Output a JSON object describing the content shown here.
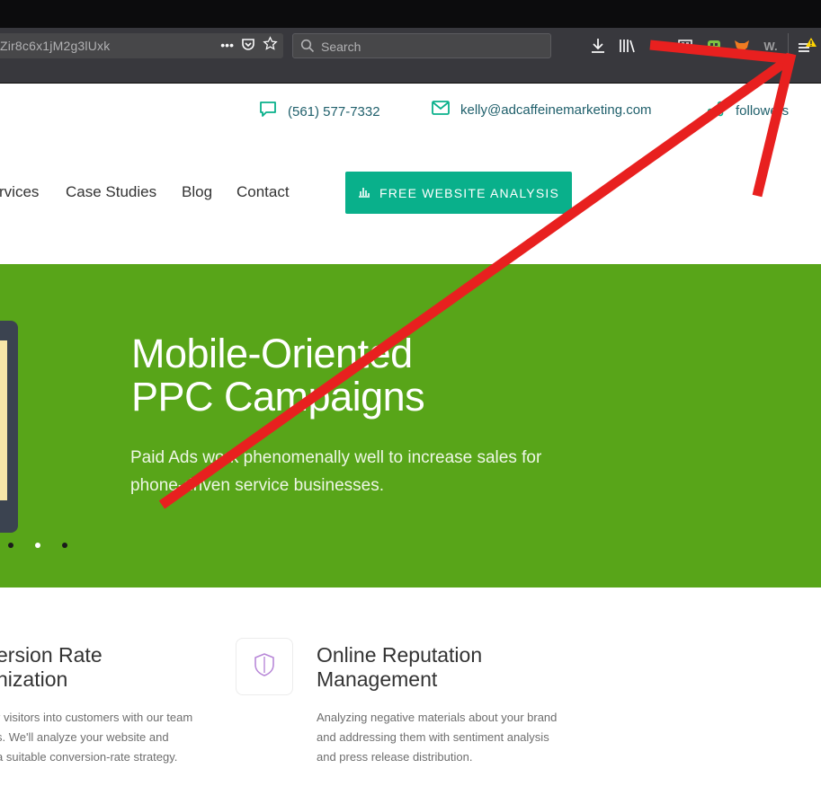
{
  "browser": {
    "url_text": "Zir8c6x1jM2g3lUxk",
    "url_more": "•••",
    "search_placeholder": "Search",
    "menu_warning_color": "#ffd400"
  },
  "contact": {
    "phone": "(561) 577-7332",
    "email": "kelly@adcaffeinemarketing.com",
    "followers": "followers"
  },
  "nav": {
    "items": [
      "rvices",
      "Case Studies",
      "Blog",
      "Contact"
    ],
    "cta_label": "FREE WEBSITE ANALYSIS"
  },
  "hero": {
    "title_line1": "Mobile-Oriented",
    "title_line2": "PPC Campaigns",
    "desc_line1": "Paid Ads work phenomenally well to increase sales for",
    "desc_line2": "phone-driven service businesses.",
    "slide_count": 3,
    "active_slide": 2,
    "background_color": "#58a519"
  },
  "services": [
    {
      "title_line1": "ersion Rate",
      "title_line2": "nization",
      "desc_lines": [
        "r visitors into customers with our team",
        "s. We'll analyze your website and",
        "a suitable conversion-rate strategy."
      ]
    },
    {
      "title_line1": "Online Reputation",
      "title_line2": "Management",
      "icon": "shield-icon",
      "desc_lines": [
        "Analyzing negative materials about your brand",
        "and addressing them with sentiment analysis",
        "and press release distribution."
      ]
    }
  ],
  "colors": {
    "cta": "#09b08b",
    "contact_text": "#1f5f6b",
    "annotation_arrow": "#e8201f"
  }
}
